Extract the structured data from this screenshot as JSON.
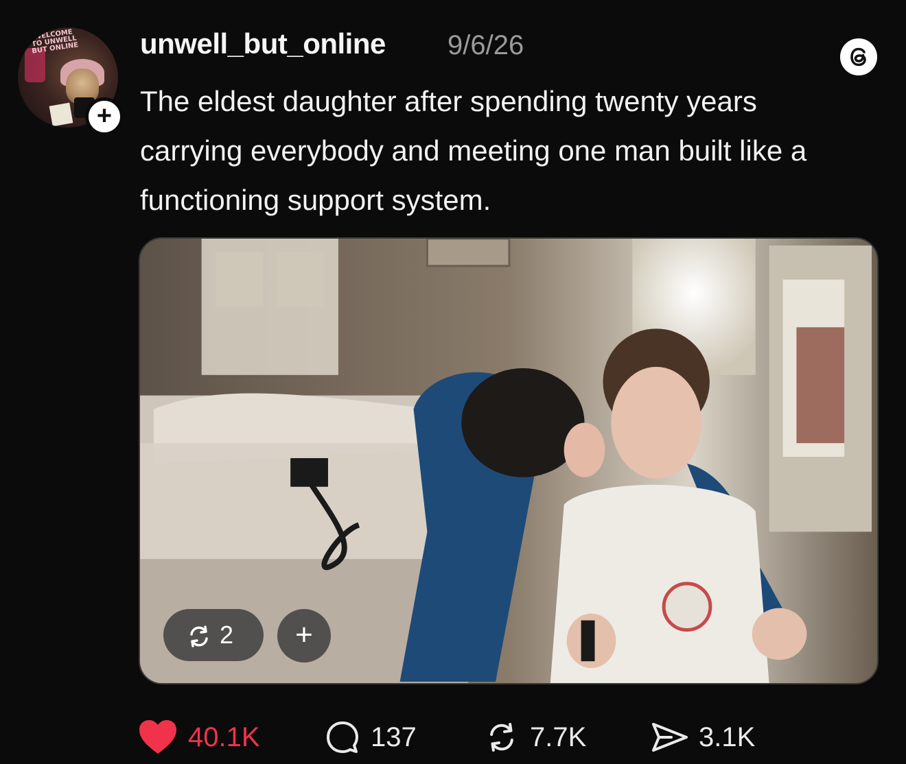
{
  "post": {
    "avatar_text": "WELCOME TO UNWELL BUT ONLINE",
    "follow_symbol": "+",
    "username": "unwell_but_online",
    "timestamp": "9/6/26",
    "caption": "The eldest daughter after spending twenty years carrying everybody and meeting one man built like a functioning support system.",
    "app_icon": "threads-logo-icon"
  },
  "media": {
    "repost_count": "2",
    "add_symbol": "+"
  },
  "actions": {
    "likes": "40.1K",
    "comments": "137",
    "reposts": "7.7K",
    "shares": "3.1K"
  },
  "colors": {
    "background": "#0b0b0b",
    "like_red": "#f0334b",
    "muted_text": "#9b9b9b"
  }
}
